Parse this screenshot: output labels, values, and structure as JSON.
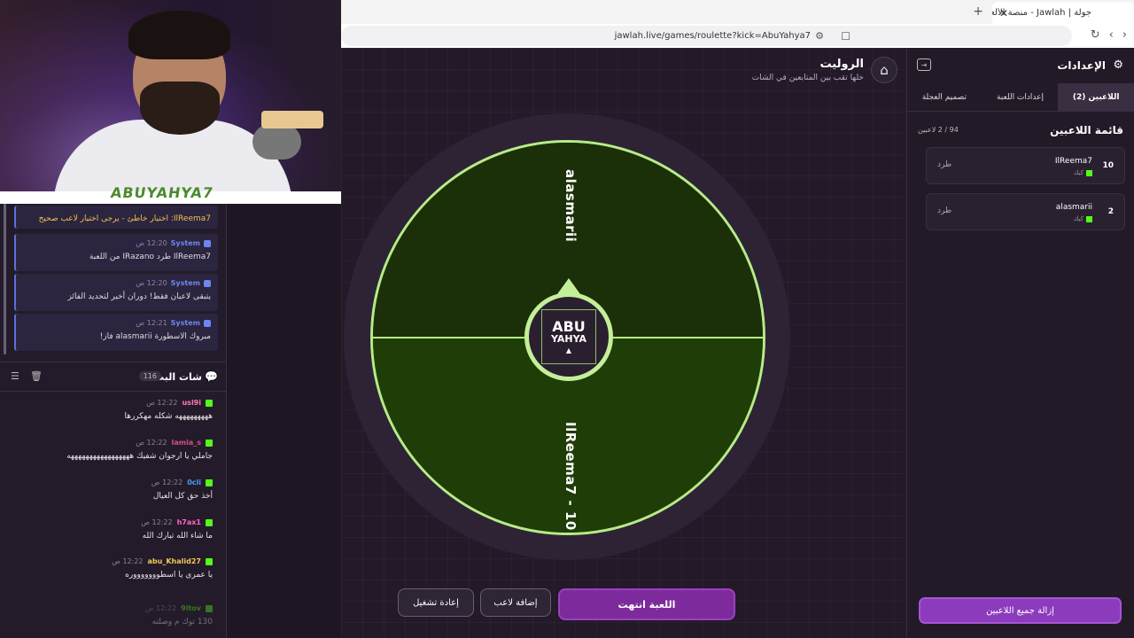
{
  "browser": {
    "tab_title": "جولة | Jawlah - منصة الألعاب التفا",
    "url": "jawlah.live/games/roulette?kick=AbuYahya7"
  },
  "webcam": {
    "overlay_name": "ABUYAHYA7"
  },
  "system_messages": [
    {
      "user": "",
      "time": "",
      "text": "IlReema7: اختيار خاطئ - يرجى اختيار لاعب صحيح"
    },
    {
      "user": "System",
      "time": "12:20 ص",
      "text": "IlReema7 طرد IRazano من اللعبة"
    },
    {
      "user": "System",
      "time": "12:20 ص",
      "text": "يتبقى لاعبان فقط! دوران أخير لتحديد الفائز"
    },
    {
      "user": "System",
      "time": "12:21 ص",
      "text": "مبروك الاسطورة alasmarii فاز!"
    }
  ],
  "chat": {
    "title": "شات البث",
    "count": "116",
    "messages": [
      {
        "user": "usl9i",
        "color": "#ff7ab8",
        "time": "12:22 ص",
        "text": "هههههههههه شكله مهكررها"
      },
      {
        "user": "lamia_s",
        "color": "#d44f8a",
        "time": "12:22 ص",
        "text": "جاملي يا ارجوان شفيك هههههههههههههههههه"
      },
      {
        "user": "0cli",
        "color": "#4f9bff",
        "time": "12:22 ص",
        "text": "أخذ حق كل العيال"
      },
      {
        "user": "h7ax1",
        "color": "#ff66c4",
        "time": "12:22 ص",
        "text": "ما شاء الله تبارك الله"
      },
      {
        "user": "abu_Khalid27",
        "color": "#f0c85a",
        "time": "12:22 ص",
        "text": "يا عمري يا اسطوووووووره"
      },
      {
        "user": "9ltov",
        "color": "#53fc18",
        "time": "12:22 ص",
        "text": "130 توك م وصلته"
      }
    ]
  },
  "game": {
    "title": "الروليت",
    "subtitle": "خلها تقب بين المتابعين في الشات",
    "wheel": {
      "segments": [
        {
          "label": "alasmarii"
        },
        {
          "label": "IlReema7 - 10"
        }
      ],
      "hub_line1": "ABU",
      "hub_line2": "YAHYA"
    },
    "buttons": {
      "end": "اللعبة انتهت",
      "add_player": "إضافة لاعب",
      "restart": "إعادة تشغيل"
    }
  },
  "settings": {
    "title": "الإعدادات",
    "tabs": [
      "اللاعبين (2)",
      "إعدادات اللعبة",
      "تصميم العجلة"
    ],
    "list_title": "قائمة اللاعبين",
    "list_count": "94 / 2 لاعبين",
    "players": [
      {
        "score": "10",
        "name": "IlReema7",
        "platform": "كيك",
        "action": "طرد"
      },
      {
        "score": "2",
        "name": "alasmarii",
        "platform": "كيك",
        "action": "طرد"
      }
    ],
    "remove_all": "إزالة جميع اللاعبين"
  }
}
